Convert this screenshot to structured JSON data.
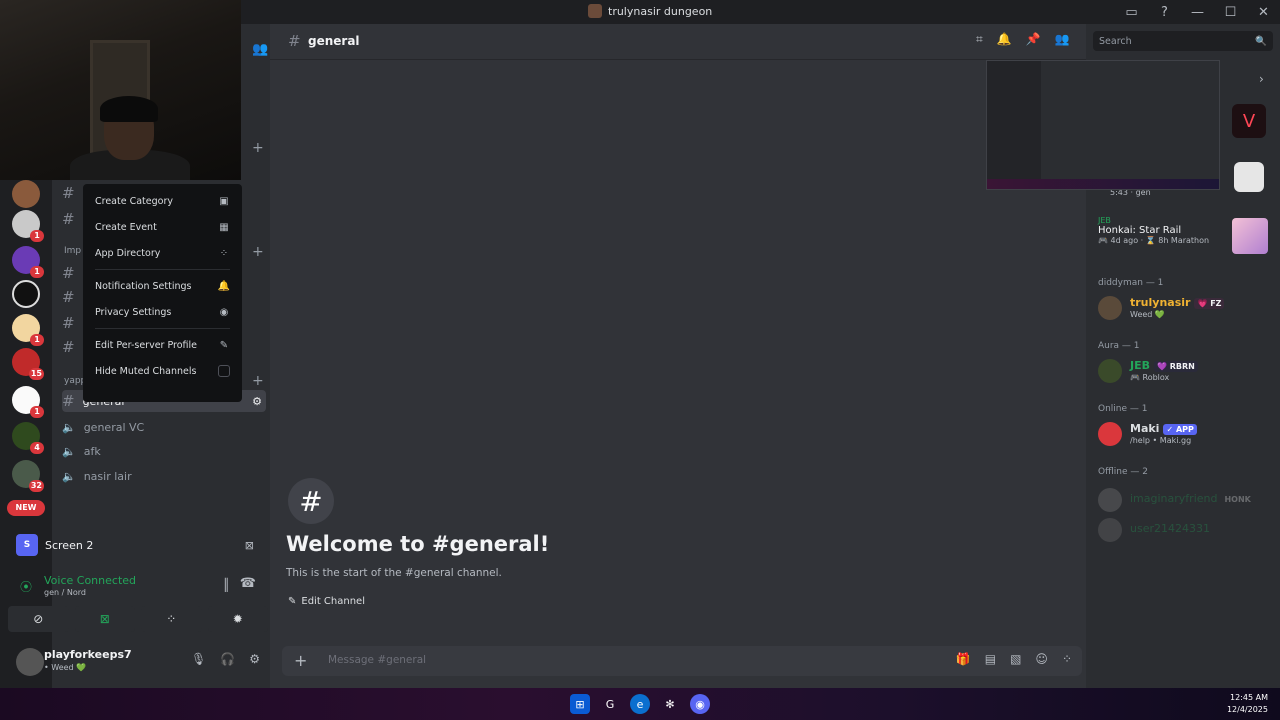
{
  "window": {
    "title": "trulynasir dungeon",
    "icons": [
      "inbox-icon",
      "help-icon",
      "minimize-icon",
      "maximize-icon",
      "close-icon"
    ]
  },
  "servers": [
    {
      "badge": ""
    },
    {
      "badge": "1"
    },
    {
      "badge": "1"
    },
    {
      "badge": ""
    },
    {
      "badge": "1"
    },
    {
      "badge": "15"
    },
    {
      "badge": "1"
    },
    {
      "badge": "4"
    },
    {
      "badge": "32"
    }
  ],
  "servers_new": "NEW",
  "sidebar": {
    "categories": [
      "Imp",
      "yapp"
    ],
    "channels": [
      {
        "type": "text",
        "label": "general",
        "active": true
      },
      {
        "type": "voice",
        "label": "general VC"
      },
      {
        "type": "voice",
        "label": "afk"
      },
      {
        "type": "voice",
        "label": "nasir lair"
      }
    ]
  },
  "context_menu": {
    "items": [
      {
        "label": "Create Category",
        "icon": "folder-plus-icon"
      },
      {
        "label": "Create Event",
        "icon": "calendar-icon"
      },
      {
        "label": "App Directory",
        "icon": "apps-icon"
      },
      {
        "label": "Notification Settings",
        "icon": "bell-icon"
      },
      {
        "label": "Privacy Settings",
        "icon": "shield-icon"
      },
      {
        "label": "Edit Per-server Profile",
        "icon": "pencil-icon"
      },
      {
        "label": "Hide Muted Channels",
        "icon": "checkbox"
      }
    ]
  },
  "screen_share": {
    "initial": "S",
    "label": "Screen 2"
  },
  "voice": {
    "status": "Voice Connected",
    "location": "gen / Nord"
  },
  "user": {
    "name": "playforkeeps7",
    "status": "• Weed 💚"
  },
  "main": {
    "channel": "general",
    "welcome_title": "Welcome to #general!",
    "welcome_sub": "This is the start of the #general channel.",
    "edit_channel": "Edit Channel",
    "composer_placeholder": "Message #general"
  },
  "search_placeholder": "Search",
  "activity": {
    "preview_meta": "5:43 · gen",
    "user": "JEB",
    "game": "Honkai: Star Rail",
    "meta": "🎮 4d ago · ⌛ 8h Marathon"
  },
  "members": {
    "groups": [
      {
        "label": "diddyman — 1",
        "members": [
          {
            "name": "trulynasir",
            "tag": "💗 FZ",
            "sub": "Weed 💚",
            "color": "#f0b232"
          }
        ]
      },
      {
        "label": "Aura — 1",
        "members": [
          {
            "name": "JEB",
            "tag": "💜 RBRN",
            "sub": "🎮 Roblox",
            "color": "#23a55a"
          }
        ]
      },
      {
        "label": "Online — 1",
        "members": [
          {
            "name": "Maki",
            "tag": "✓ APP",
            "sub": "/help • Maki.gg",
            "color": "#dbdee1"
          }
        ]
      },
      {
        "label": "Offline — 2",
        "members": [
          {
            "name": "imaginaryfriend",
            "tag": "HONK",
            "sub": "",
            "color": "#23a55a"
          },
          {
            "name": "user21424331",
            "tag": "",
            "sub": "",
            "color": "#23a55a"
          }
        ]
      }
    ]
  },
  "taskbar": {
    "time": "12:45 AM",
    "date": "12/4/2025"
  },
  "colors": {
    "accent": "#5865f2",
    "online": "#23a55a",
    "danger": "#da373c"
  }
}
